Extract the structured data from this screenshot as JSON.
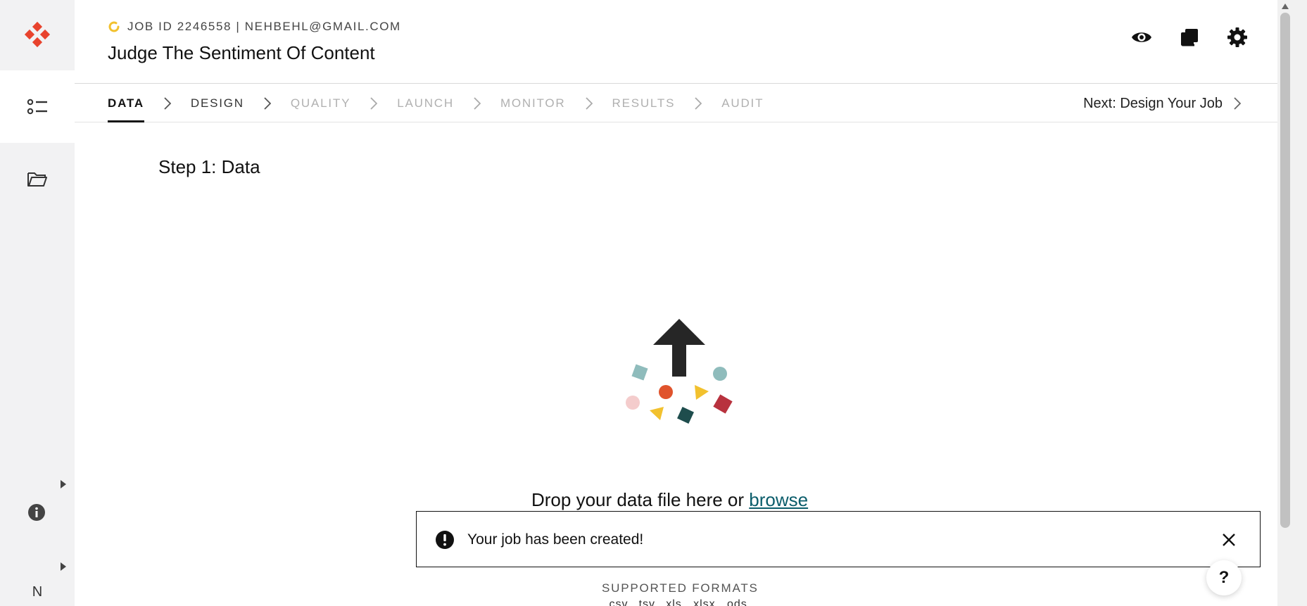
{
  "app": {
    "brand_color": "#e8432d",
    "rail": {
      "items": [
        {
          "icon": "job-list-icon",
          "active": true
        },
        {
          "icon": "folder-icon",
          "active": false
        }
      ],
      "info_icon": "info-icon",
      "avatar_initial": "N"
    }
  },
  "header": {
    "status_icon": "loading-icon",
    "status_color": "#f2c12e",
    "job_meta": "JOB ID 2246558 | NEHBEHL@GMAIL.COM",
    "job_title": "Judge The Sentiment Of Content",
    "actions": [
      {
        "icon": "eye-icon",
        "name": "preview"
      },
      {
        "icon": "copy-icon",
        "name": "copy"
      },
      {
        "icon": "gear-icon",
        "name": "settings"
      }
    ]
  },
  "steps": {
    "items": [
      {
        "label": "DATA",
        "state": "active"
      },
      {
        "label": "DESIGN",
        "state": "done"
      },
      {
        "label": "QUALITY",
        "state": "disabled"
      },
      {
        "label": "LAUNCH",
        "state": "disabled"
      },
      {
        "label": "MONITOR",
        "state": "disabled"
      },
      {
        "label": "RESULTS",
        "state": "disabled"
      },
      {
        "label": "AUDIT",
        "state": "disabled"
      }
    ],
    "next_label": "Next: Design Your Job"
  },
  "main": {
    "heading": "Step 1: Data",
    "drop_text": "Drop your data file here or",
    "browse_label": "browse",
    "supported_label": "SUPPORTED FORMATS",
    "formats": ".csv, .tsv, .xls, .xlsx, .ods"
  },
  "toast": {
    "icon": "alert-icon",
    "message": "Your job has been created!"
  },
  "help": {
    "label": "?"
  }
}
